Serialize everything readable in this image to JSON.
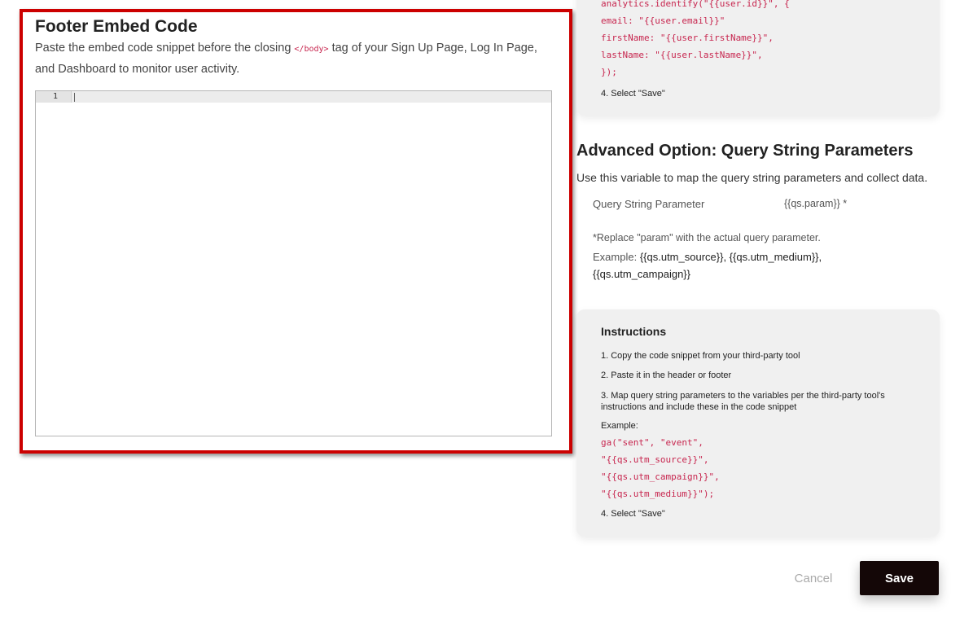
{
  "footer": {
    "title": "Footer Embed Code",
    "desc_before": "Paste the embed code snippet before the closing ",
    "desc_code": "</body>",
    "desc_after": " tag of your Sign Up Page, Log In Page, and Dashboard to monitor user activity.",
    "editor": {
      "line_number": "1",
      "value": ""
    }
  },
  "top_card": {
    "code_lines": [
      "analytics.identify(\"{{user.id}}\", {",
      "email: \"{{user.email}}\"",
      "firstName: \"{{user.firstName}}\",",
      "lastName: \"{{user.lastName}}\",",
      "});"
    ],
    "step4": "4. Select \"Save\""
  },
  "advanced": {
    "title": "Advanced Option: Query String Parameters",
    "desc": "Use this variable to map the query string parameters and collect data.",
    "param_label": "Query String Parameter",
    "param_value": "{{qs.param}} *",
    "replace_note": "*Replace \"param\" with the actual query parameter.",
    "example_label": "Example: ",
    "example_values": "{{qs.utm_source}}, {{qs.utm_medium}}, {{qs.utm_campaign}}"
  },
  "instructions": {
    "title": "Instructions",
    "steps": [
      "1. Copy the code snippet from your third-party tool",
      "2. Paste it in the header or footer",
      "3. Map query string parameters to the variables per the third-party tool's instructions and include these in the code snippet"
    ],
    "example_label": "Example:",
    "code_lines": [
      "ga(\"sent\", \"event\",",
      "\"{{qs.utm_source}}\",",
      "\"{{qs.utm_campaign}}\",",
      "\"{{qs.utm_medium}}\");"
    ],
    "step4": "4. Select \"Save\""
  },
  "actions": {
    "cancel": "Cancel",
    "save": "Save"
  },
  "colors": {
    "highlight": "#cc0000",
    "code": "#c7254e",
    "save_bg": "#140707"
  }
}
